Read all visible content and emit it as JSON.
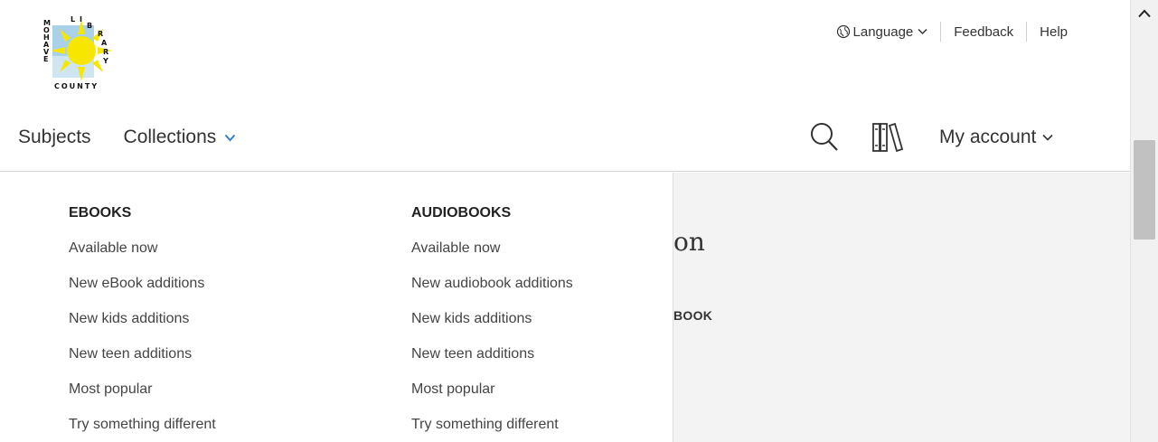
{
  "logo": {
    "alt_letters_left": "MOHAVE",
    "alt_letters_right": "LIBRARY",
    "alt_bottom": "COUNTY"
  },
  "utility": {
    "language_label": "Language",
    "feedback_label": "Feedback",
    "help_label": "Help"
  },
  "nav": {
    "subjects_label": "Subjects",
    "collections_label": "Collections",
    "account_label": "My account"
  },
  "dropdown": {
    "ebooks": {
      "heading": "EBOOKS",
      "links": [
        "Available now",
        "New eBook additions",
        "New kids additions",
        "New teen additions",
        "Most popular",
        "Try something different"
      ]
    },
    "audiobooks": {
      "heading": "AUDIOBOOKS",
      "links": [
        "Available now",
        "New audiobook additions",
        "New kids additions",
        "New teen additions",
        "Most popular",
        "Try something different"
      ]
    }
  },
  "background_page": {
    "heading_fragment": "on",
    "sub_fragment": "BOOK"
  },
  "icons": {
    "globe": "globe-icon",
    "search": "search-icon",
    "bookshelf": "bookshelf-icon",
    "chevron": "chevron-down-icon"
  },
  "colors": {
    "accent": "#2f7fd3",
    "text": "#333333",
    "sun": "#f7e600",
    "logo_sky": "#a9d2ea"
  }
}
